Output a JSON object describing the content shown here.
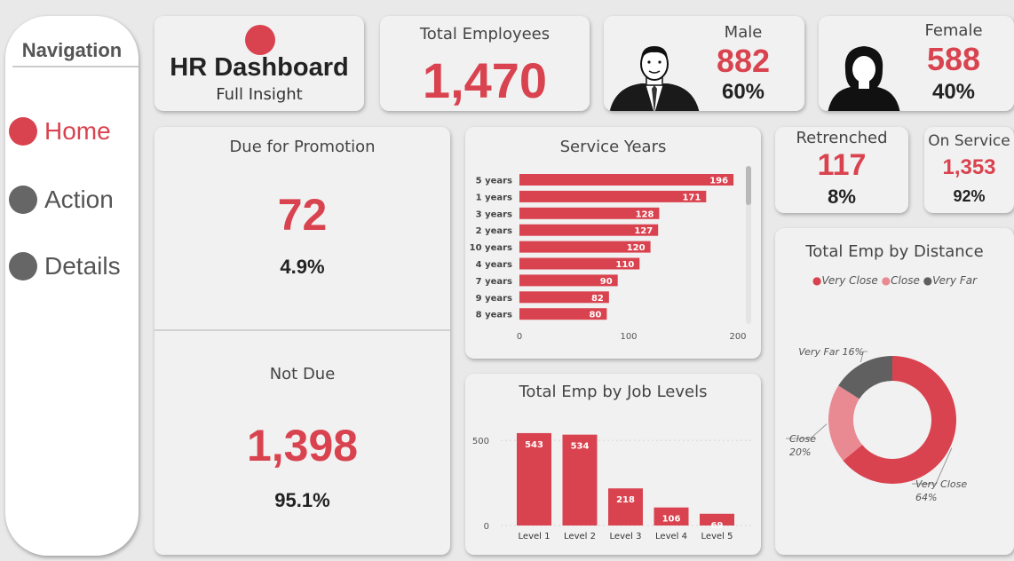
{
  "nav": {
    "title": "Navigation",
    "items": [
      {
        "label": "Home",
        "active": true
      },
      {
        "label": "Action",
        "active": false
      },
      {
        "label": "Details",
        "active": false
      }
    ]
  },
  "header": {
    "title": "HR Dashboard",
    "subtitle": "Full Insight"
  },
  "total": {
    "label": "Total Employees",
    "value": "1,470"
  },
  "male": {
    "label": "Male",
    "value": "882",
    "pct": "60%"
  },
  "female": {
    "label": "Female",
    "value": "588",
    "pct": "40%"
  },
  "promotion": {
    "due_label": "Due for Promotion",
    "due_value": "72",
    "due_pct": "4.9%",
    "notdue_label": "Not Due",
    "notdue_value": "1,398",
    "notdue_pct": "95.1%"
  },
  "retrenched": {
    "label": "Retrenched",
    "value": "117",
    "pct": "8%"
  },
  "onservice": {
    "label": "On Service",
    "value": "1,353",
    "pct": "92%"
  },
  "colors": {
    "accent": "#d9434f",
    "close": "#e98a92",
    "very_far": "#606060"
  },
  "chart_data": [
    {
      "type": "bar",
      "orientation": "horizontal",
      "title": "Service Years",
      "categories": [
        "5 years",
        "1 years",
        "3 years",
        "2 years",
        "10 years",
        "4 years",
        "7 years",
        "9 years",
        "8 years"
      ],
      "values": [
        196,
        171,
        128,
        127,
        120,
        110,
        90,
        82,
        80
      ],
      "x_ticks": [
        "0",
        "100",
        "200"
      ],
      "xlim": [
        0,
        200
      ]
    },
    {
      "type": "bar",
      "title": "Total Emp by Job Levels",
      "categories": [
        "Level 1",
        "Level 2",
        "Level 3",
        "Level 4",
        "Level 5"
      ],
      "values": [
        543,
        534,
        218,
        106,
        69
      ],
      "y_ticks": [
        "0",
        "500"
      ],
      "ylim": [
        0,
        600
      ]
    },
    {
      "type": "pie",
      "title": "Total Emp by Distance",
      "legend_position": "top",
      "categories": [
        "Very Close",
        "Close",
        "Very Far"
      ],
      "values": [
        64,
        20,
        16
      ],
      "slice_labels": [
        "Very Close 64%",
        "Close 20%",
        "Very Far 16%"
      ]
    }
  ]
}
